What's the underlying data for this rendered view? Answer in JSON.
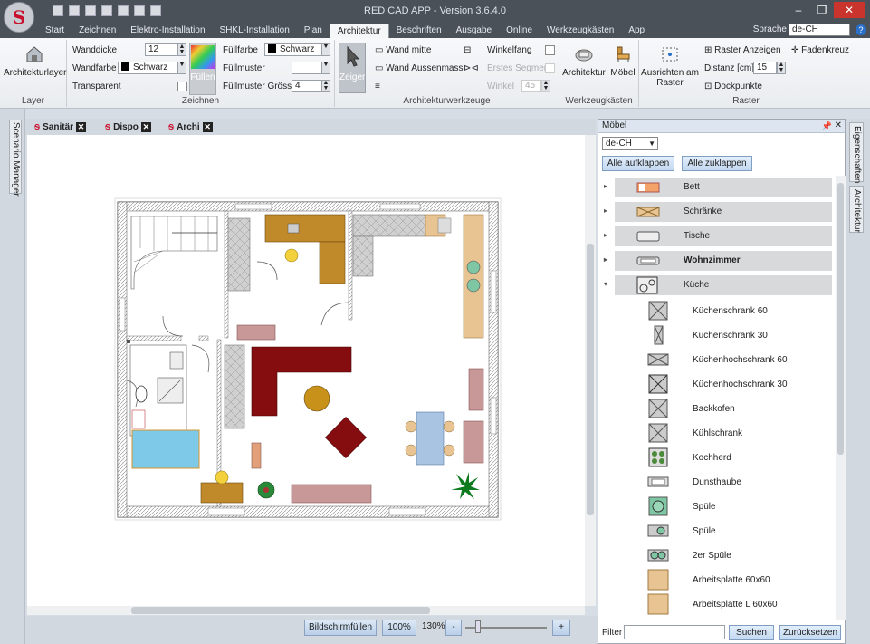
{
  "window": {
    "title": "RED CAD APP - Version 3.6.4.0",
    "app_logo": "S",
    "minimize": "–",
    "restore": "❐",
    "close": "✕"
  },
  "menu": {
    "tabs": [
      "Start",
      "Zeichnen",
      "Elektro-Installation",
      "SHKL-Installation",
      "Plan",
      "Architektur",
      "Beschriften",
      "Ausgabe",
      "Online",
      "Werkzeugkästen",
      "App"
    ],
    "active_tab": "Architektur",
    "language_label": "Sprache",
    "language_value": "de-CH",
    "help_icon": "?"
  },
  "ribbon": {
    "layer": {
      "button": "Architekturlayer",
      "group": "Layer"
    },
    "zeichnen": {
      "wanddicke_label": "Wanddicke",
      "wanddicke_value": "12",
      "wandfarbe_label": "Wandfarbe",
      "wandfarbe_value": "Schwarz",
      "transparent_label": "Transparent",
      "fuellen_label": "Füllen",
      "fuellfarbe_label": "Füllfarbe",
      "fuellfarbe_value": "Schwarz",
      "fuellmuster_label": "Füllmuster",
      "fuellmuster_groesse_label": "Füllmuster Grösse",
      "fuellmuster_groesse_value": "4",
      "group": "Zeichnen"
    },
    "architekturwerkzeuge": {
      "zeiger": "Zeiger",
      "wand_mitte": "Wand mitte",
      "wand_aussenmass": "Wand Aussenmass",
      "winkelfang": "Winkelfang",
      "erstes_segment": "Erstes Segment",
      "winkel_label": "Winkel",
      "winkel_value": "45",
      "group": "Architekturwerkzeuge"
    },
    "werkzeugkaesten": {
      "architektur": "Architektur",
      "moebel": "Möbel",
      "group": "Werkzeugkästen"
    },
    "raster": {
      "ausrichten": "Ausrichten am Raster",
      "raster_anzeigen": "Raster Anzeigen",
      "fadenkreuz": "Fadenkreuz",
      "distanz_label": "Distanz [cm]",
      "distanz_value": "15",
      "dockpunkte": "Dockpunkte",
      "group": "Raster"
    }
  },
  "left_sidebar": {
    "scenario_manager": "Scenario Manager"
  },
  "doc_tabs": [
    {
      "label": "Sanitär"
    },
    {
      "label": "Dispo"
    },
    {
      "label": "Archi"
    }
  ],
  "status": {
    "fullscreen": "Bildschirmfüllen",
    "zoom100": "100%",
    "zoom_value": "130%",
    "zoom_minus": "-",
    "zoom_plus": "+"
  },
  "panel": {
    "title": "Möbel",
    "language": "de-CH",
    "expand_all": "Alle aufklappen",
    "collapse_all": "Alle zuklappen",
    "categories": [
      {
        "label": "Bett",
        "expanded": false
      },
      {
        "label": "Schränke",
        "expanded": false
      },
      {
        "label": "Tische",
        "expanded": false
      },
      {
        "label": "Wohnzimmer",
        "expanded": false
      },
      {
        "label": "Küche",
        "expanded": true
      }
    ],
    "kitchen_items": [
      {
        "label": "Küchenschrank 60",
        "icon": "cabinet-icon"
      },
      {
        "label": "Küchenschrank 30",
        "icon": "cabinet-narrow-icon"
      },
      {
        "label": "Küchenhochschrank 60",
        "icon": "tall-cabinet-icon"
      },
      {
        "label": "Küchenhochschrank 30",
        "icon": "tall-cabinet-narrow-icon"
      },
      {
        "label": "Backkofen",
        "icon": "oven-icon"
      },
      {
        "label": "Kühlschrank",
        "icon": "fridge-icon"
      },
      {
        "label": "Kochherd",
        "icon": "stove-icon"
      },
      {
        "label": "Dunsthaube",
        "icon": "hood-icon"
      },
      {
        "label": "Spüle",
        "icon": "sink-round-icon"
      },
      {
        "label": "Spüle",
        "icon": "sink-icon"
      },
      {
        "label": "2er Spüle",
        "icon": "double-sink-icon"
      },
      {
        "label": "Arbeitsplatte 60x60",
        "icon": "countertop-icon"
      },
      {
        "label": "Arbeitsplatte L 60x60",
        "icon": "countertop-l-icon"
      }
    ],
    "filter_label": "Filter",
    "search": "Suchen",
    "reset": "Zurücksetzen"
  },
  "right_tabs": {
    "eigenschaften": "Eigenschaften",
    "architektur": "Architektur"
  }
}
